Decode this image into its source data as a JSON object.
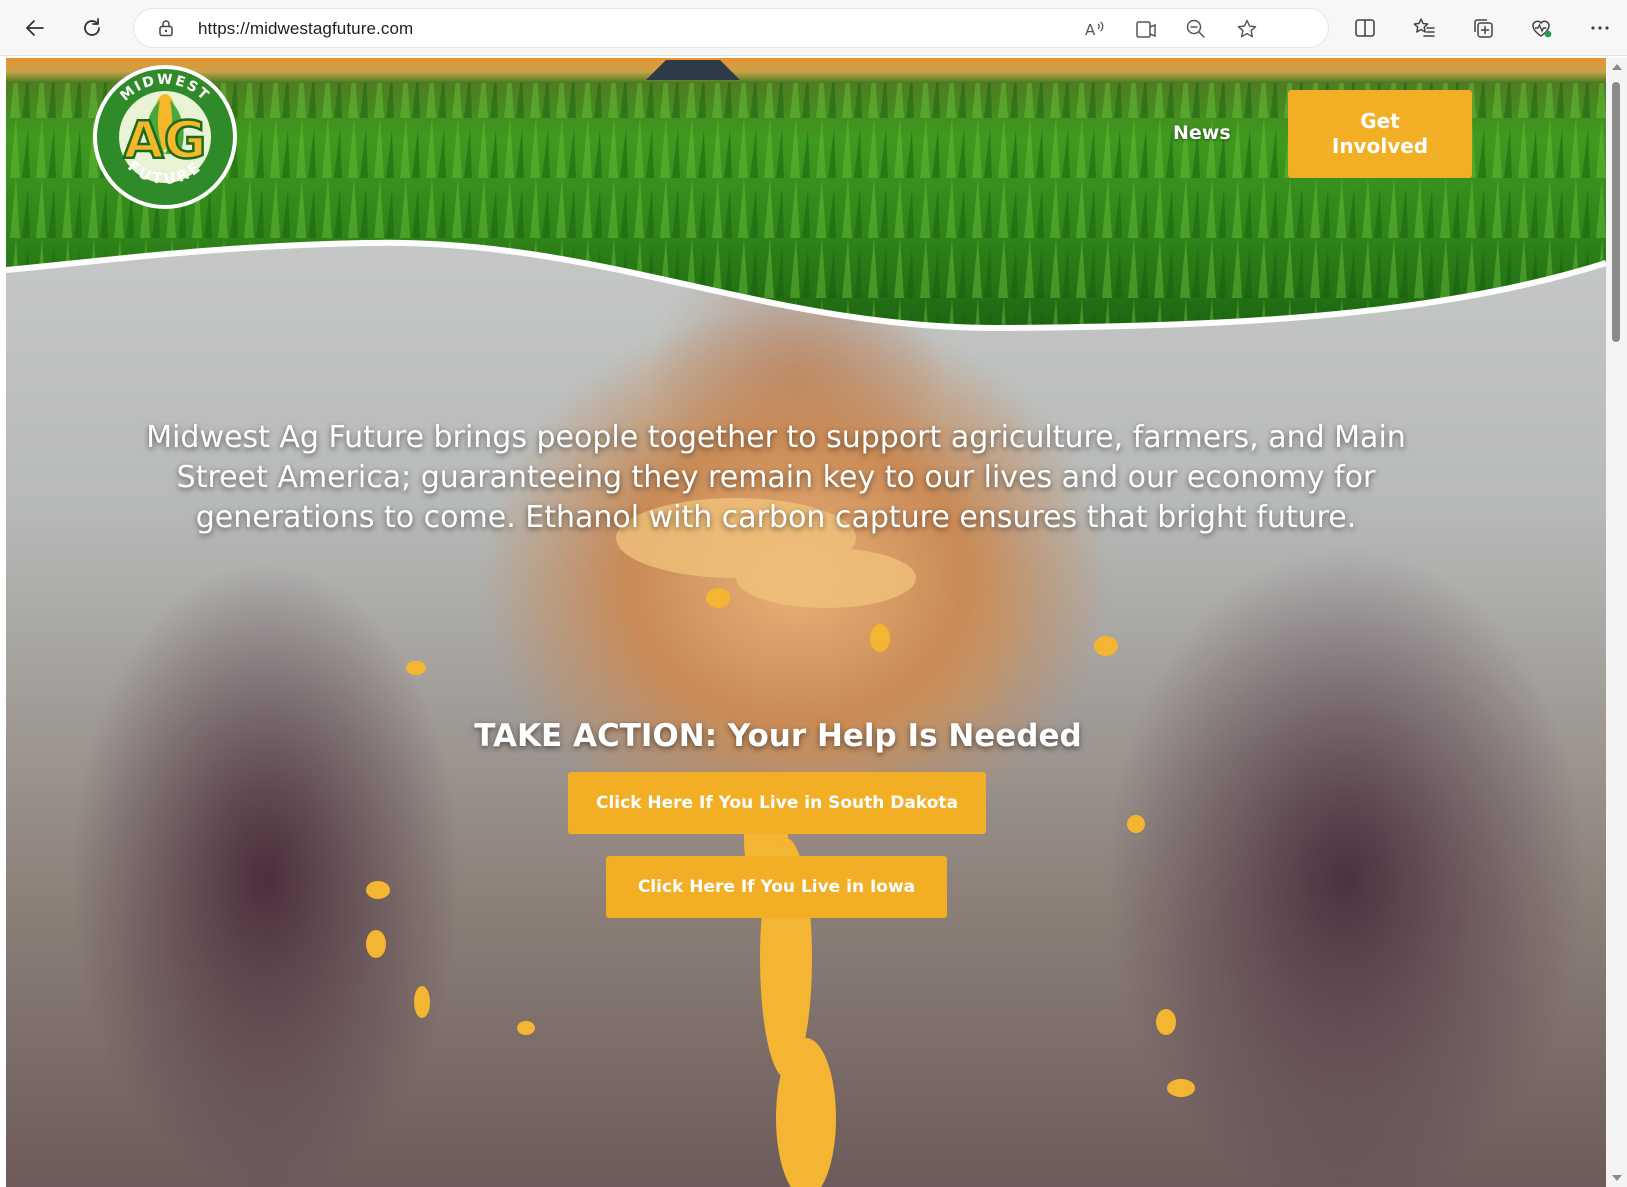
{
  "browser": {
    "url": "https://midwestagfuture.com"
  },
  "site": {
    "logo_text": {
      "top": "MIDWEST",
      "middle": "AG",
      "bottom": "FUTURE"
    },
    "nav": {
      "news_label": "News",
      "get_involved_label": "Get Involved"
    },
    "hero": {
      "mission": "Midwest Ag Future brings people together to support agriculture, farmers, and Main Street America; guaranteeing they remain key to our lives and our economy for generations to come. Ethanol with carbon capture ensures that bright future.",
      "action_heading": "TAKE ACTION: Your Help Is Needed",
      "cta_south_dakota": "Click Here If You Live in South Dakota",
      "cta_iowa": "Click Here If You Live in Iowa"
    }
  },
  "colors": {
    "accent": "#f2ae24",
    "logo_green": "#2f8a2a",
    "logo_gold": "#f5b82b"
  }
}
